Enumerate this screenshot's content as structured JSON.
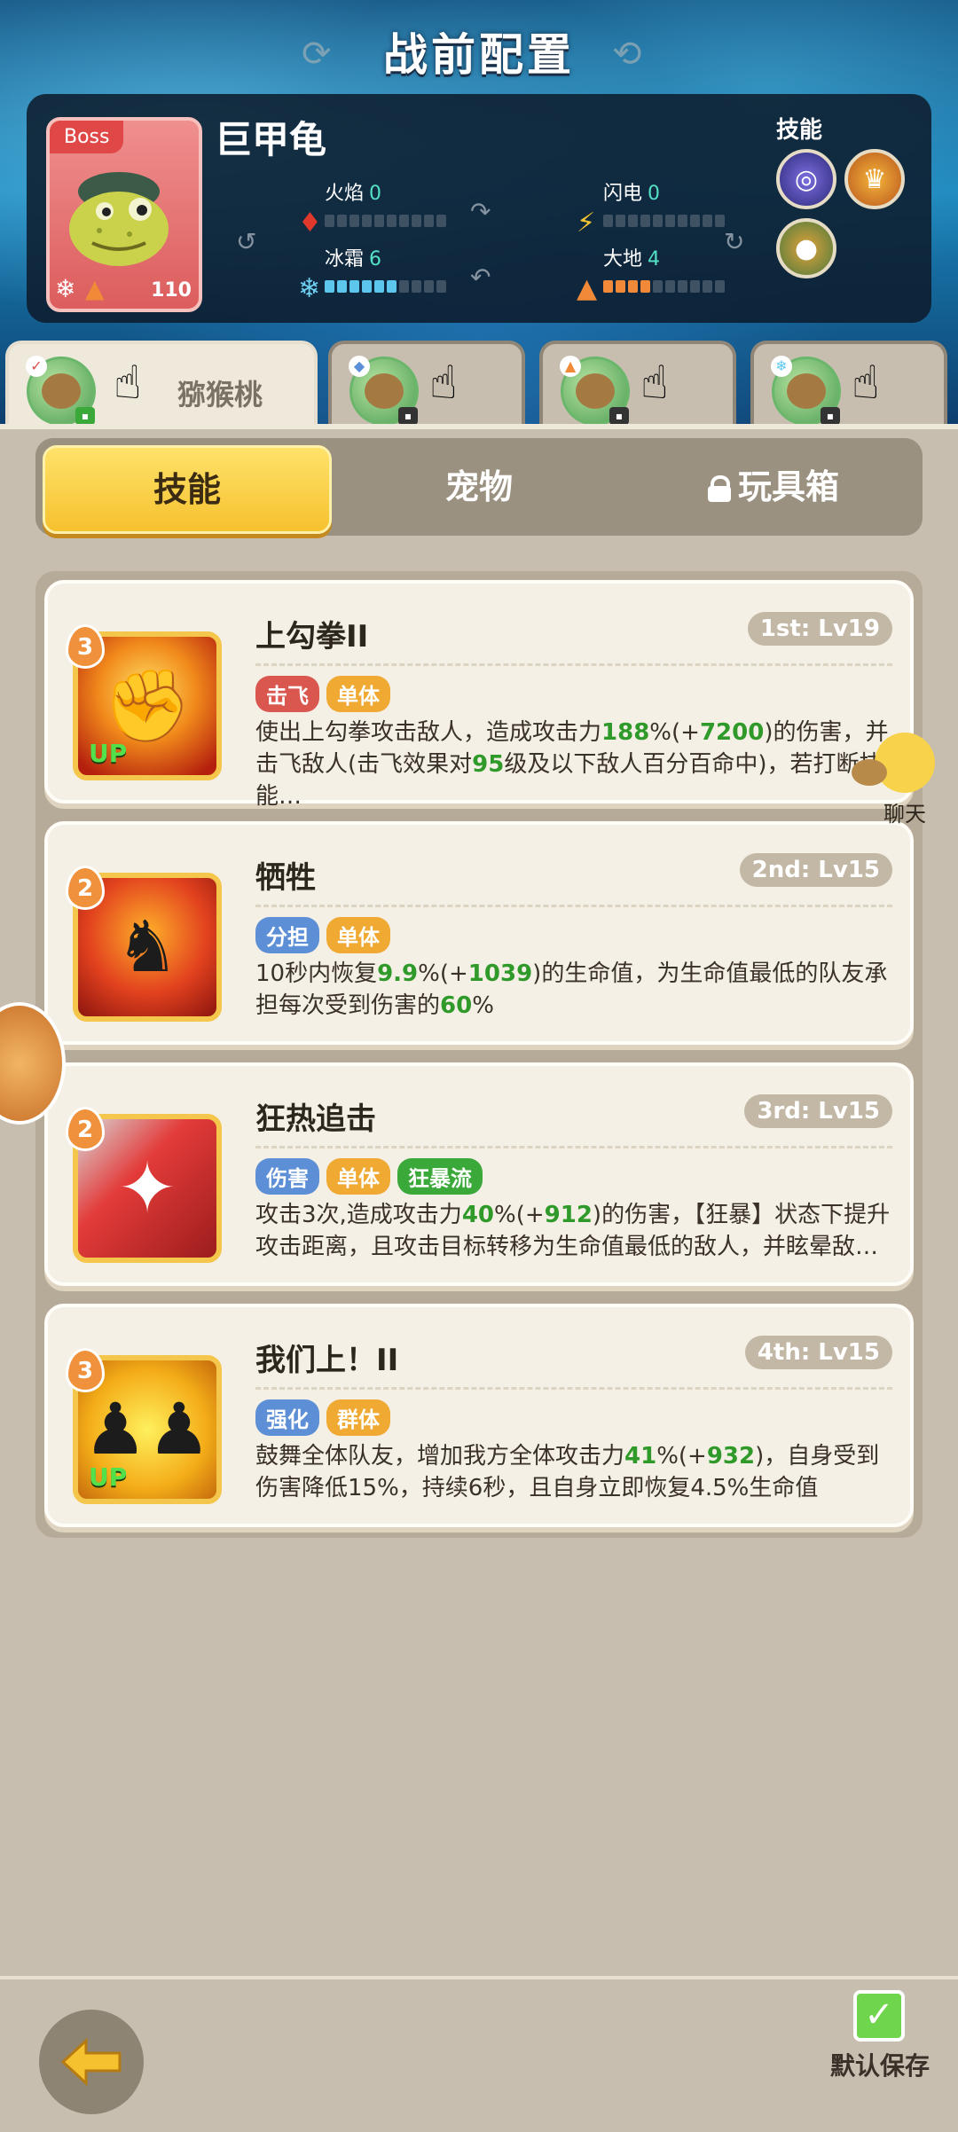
{
  "header": {
    "title": "战前配置"
  },
  "boss": {
    "tag": "Boss",
    "name": "巨甲龟",
    "level": "110",
    "stats": {
      "fire": {
        "label": "火焰",
        "value": "0",
        "level": 0
      },
      "lightning": {
        "label": "闪电",
        "value": "0",
        "level": 0
      },
      "ice": {
        "label": "冰霜",
        "value": "6",
        "level": 6
      },
      "earth": {
        "label": "大地",
        "value": "4",
        "level": 4
      }
    },
    "skills_label": "技能"
  },
  "characters": [
    {
      "name": "猕猴桃",
      "active": true
    },
    {
      "name": "",
      "active": false
    },
    {
      "name": "",
      "active": false
    },
    {
      "name": "",
      "active": false
    }
  ],
  "tabs": {
    "skills": "技能",
    "pets": "宠物",
    "toybox": "玩具箱"
  },
  "skills": [
    {
      "title": "上勾拳II",
      "level_label": "1st: Lv19",
      "badge": "3",
      "has_up": true,
      "tags": [
        "击飞",
        "单体"
      ],
      "desc_html": "使出上勾拳攻击敌人，造成攻击力<span class='g'>188</span>%(+<span class='g'>7200</span>)的伤害，并击飞敌人(击飞效果对<span class='g'>95</span>级及以下敌人百分百命中)，若打断技能…"
    },
    {
      "title": "牺牲",
      "level_label": "2nd: Lv15",
      "badge": "2",
      "has_up": false,
      "tags": [
        "分担",
        "单体"
      ],
      "desc_html": "10秒内恢复<span class='g'>9.9</span>%(+<span class='g'>1039</span>)的生命值，为生命值最低的队友承担每次受到伤害的<span class='g'>60</span>%"
    },
    {
      "title": "狂热追击",
      "level_label": "3rd: Lv15",
      "badge": "2",
      "has_up": false,
      "tags": [
        "伤害",
        "单体",
        "狂暴流"
      ],
      "desc_html": "攻击3次,造成攻击力<span class='g'>40</span>%(+<span class='g'>912</span>)的伤害，【狂暴】状态下提升攻击距离，且攻击目标转移为生命值最低的敌人，并眩晕敌…"
    },
    {
      "title": "我们上！II",
      "level_label": "4th: Lv15",
      "badge": "3",
      "has_up": true,
      "tags": [
        "强化",
        "群体"
      ],
      "desc_html": "鼓舞全体队友，增加我方全体攻击力<span class='g'>41</span>%(+<span class='g'>932</span>)，自身受到伤害降低15%，持续6秒，且自身立即恢复4.5%生命值"
    }
  ],
  "up_text": "UP",
  "chat": {
    "label": "聊天"
  },
  "footer": {
    "save_label": "默认保存"
  },
  "colors": {
    "tag_red": "#d9574f",
    "tag_blue": "#5c8fd6",
    "tag_orange": "#f0a932",
    "tag_green": "#3aa93a",
    "accent_yellow": "#f6c12f"
  }
}
